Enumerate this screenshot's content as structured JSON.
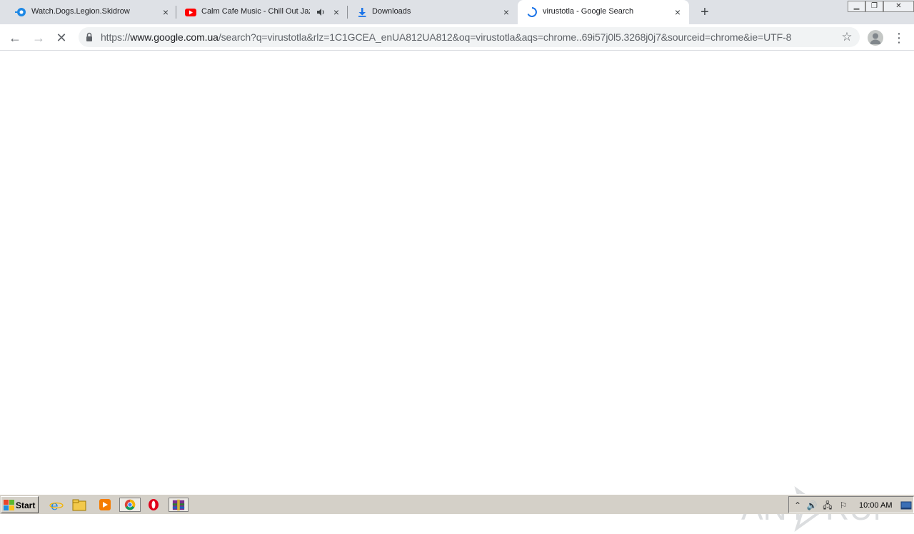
{
  "browser": {
    "tabs": [
      {
        "title": "Watch.Dogs.Legion.Skidrow",
        "favicon": "site-logo-icon",
        "close": "×"
      },
      {
        "title": "Calm Cafe Music - Chill Out Jazz",
        "favicon": "youtube-icon",
        "audio": "audio-playing-icon",
        "close": "×"
      },
      {
        "title": "Downloads",
        "favicon": "download-icon",
        "close": "×"
      },
      {
        "title": "virustotla - Google Search",
        "favicon": "loading-spinner-icon",
        "close": "×",
        "active": true
      }
    ],
    "new_tab": "+",
    "window_controls": {
      "minimize": "▁",
      "restore": "❐",
      "close": "✕"
    }
  },
  "toolbar": {
    "back": "←",
    "forward": "→",
    "stop": "✕",
    "url_scheme": "https://",
    "url_host": "www.google.com.ua",
    "url_path": "/search?q=virustotla&rlz=1C1GCEA_enUA812UA812&oq=virustotla&aqs=chrome..69i57j0l5.3268j0j7&sourceid=chrome&ie=UTF-8",
    "star": "☆",
    "menu": "⋮"
  },
  "watermark": {
    "text": "ANY RUN"
  },
  "taskbar": {
    "start_label": "Start",
    "quick_launch": [
      "internet-explorer-icon",
      "file-explorer-icon",
      "media-player-icon",
      "chrome-icon",
      "opera-icon",
      "winrar-icon"
    ],
    "clock": "10:00 AM"
  },
  "colors": {
    "tabstrip": "#dee1e6",
    "omnibox": "#f1f3f4",
    "taskbar": "#d4d0c8",
    "accent": "#1a73e8"
  }
}
